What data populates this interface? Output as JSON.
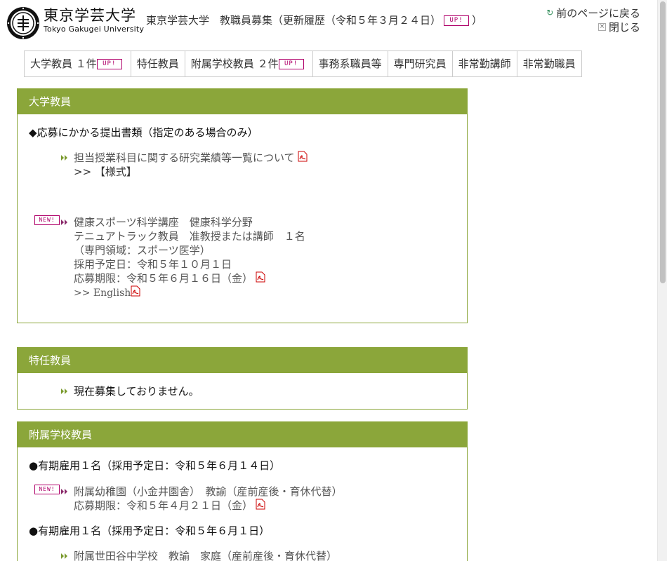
{
  "header": {
    "logo_jp": "東京学芸大学",
    "logo_en": "Tokyo Gakugei University",
    "title_prefix": "東京学芸大学　教職員募集（",
    "title_link": "更新履歴（令和５年３月２４日）",
    "title_suffix": "）",
    "up_label": "UP!",
    "back_label": "前のページに戻る",
    "close_label": "閉じる"
  },
  "tabs": [
    {
      "label": "大学教員 １件",
      "up": true
    },
    {
      "label": "特任教員",
      "up": false
    },
    {
      "label": "附属学校教員 ２件",
      "up": true
    },
    {
      "label": "事務系職員等",
      "up": false
    },
    {
      "label": "専門研究員",
      "up": false
    },
    {
      "label": "非常勤講師",
      "up": false
    },
    {
      "label": "非常勤職員",
      "up": false
    }
  ],
  "new_label": "NEW!",
  "sections": {
    "university": {
      "title": "大学教員",
      "heading": "◆応募にかかる提出書類（指定のある場合のみ）",
      "doc_link": "担当授業科目に関する研究業績等一覧について",
      "form_link": ">> 【様式】",
      "job": {
        "line1": "健康スポーツ科学講座　健康科学分野",
        "line2": "テニュアトラック教員　准教授または講師　１名",
        "line3": "（専門領域：スポーツ医学）",
        "line4": "採用予定日：令和５年１０月１日",
        "line5": "応募期限：令和５年６月１６日（金）",
        "english": ">> English"
      }
    },
    "special": {
      "title": "特任教員",
      "notice": "現在募集しておりません。"
    },
    "attached": {
      "title": "附属学校教員",
      "heading1": "●有期雇用１名（採用予定日：令和５年６月１４日）",
      "job1_line1": "附属幼稚園（小金井園舎）　教諭（産前産後・育休代替）",
      "job1_line2": "応募期限：令和５年４月２１日（金）",
      "heading2": "●有期雇用１名（採用予定日：令和５年６月１日）",
      "job2_line1": "附属世田谷中学校　教諭　家庭（産前産後・育休代替）"
    }
  },
  "colors": {
    "section_green": "#8ba63a",
    "badge_magenta": "#b0006a"
  }
}
